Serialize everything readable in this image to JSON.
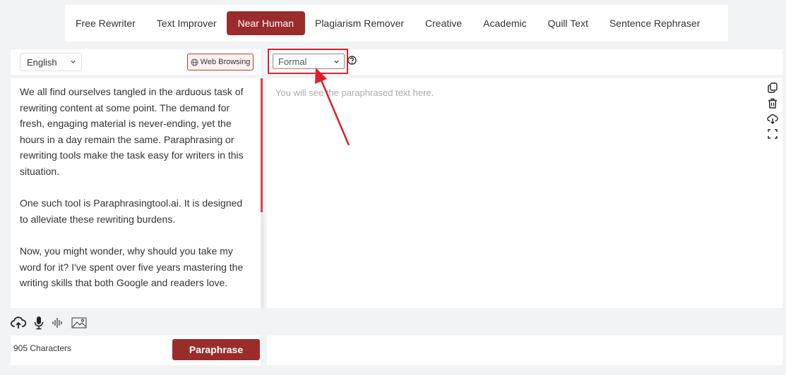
{
  "tabs": [
    {
      "label": "Free Rewriter",
      "active": false
    },
    {
      "label": "Text Improver",
      "active": false
    },
    {
      "label": "Near Human",
      "active": true
    },
    {
      "label": "Plagiarism Remover",
      "active": false
    },
    {
      "label": "Creative",
      "active": false
    },
    {
      "label": "Academic",
      "active": false
    },
    {
      "label": "Quill Text",
      "active": false
    },
    {
      "label": "Sentence Rephraser",
      "active": false
    }
  ],
  "input_panel": {
    "language": "English",
    "web_browsing_label": "Web Browsing",
    "paragraphs": [
      "We all find ourselves tangled in the arduous task of rewriting content at some point. The demand for fresh, engaging material is never-ending, yet the hours in a day remain the same. Paraphrasing or rewriting tools make the task easy for writers in this situation.",
      "One such tool is Paraphrasingtool.ai. It is designed to alleviate these rewriting burdens.",
      "Now, you might wonder, why should you take my word for it? I've spent over five years mastering the writing skills that both Google and readers love."
    ],
    "char_count": "905 Characters",
    "paraphrase_label": "Paraphrase"
  },
  "output_panel": {
    "mode": "Formal",
    "placeholder": "You will see the paraphrased text here."
  },
  "colors": {
    "accent": "#9b2c2c",
    "highlight": "#e01e2b"
  }
}
